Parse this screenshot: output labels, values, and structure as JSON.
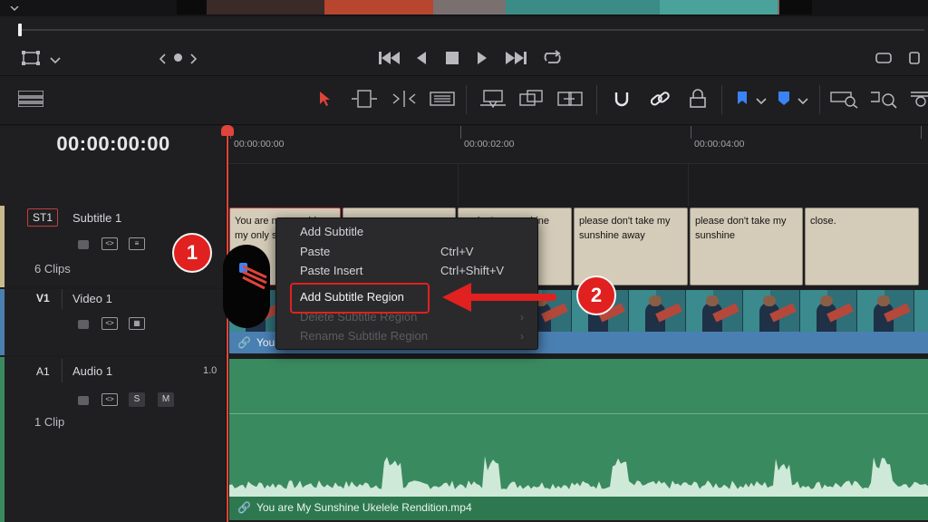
{
  "transport": {
    "viewer_icon": "viewer-mode-icon",
    "dropdown_icon": "chevron-down-icon",
    "nav_icons": [
      "chevron-left-icon",
      "dot-icon",
      "chevron-right-icon"
    ],
    "controls": [
      "skip-to-start-icon",
      "step-back-icon",
      "stop-icon",
      "play-icon",
      "skip-to-end-icon",
      "loop-icon"
    ],
    "right_icons": [
      "fullscreen-icon",
      "more-icon"
    ]
  },
  "timeline": {
    "timecode": "00:00:00:00",
    "ruler_marks": [
      "00:00:00:00",
      "00:00:02:00",
      "00:00:04:00"
    ]
  },
  "tracks": {
    "subtitle": {
      "badge": "ST1",
      "name": "Subtitle 1",
      "info": "6 Clips",
      "clips": [
        "You are my sunshine my only sunshine",
        "",
        "... don't ... sunshine",
        "please don't take my sunshine away",
        "please don't take my sunshine",
        "close."
      ]
    },
    "video": {
      "badge": "V1",
      "name": "Video 1",
      "clip_label": "You"
    },
    "audio": {
      "badge": "A1",
      "name": "Audio 1",
      "level": "1.0",
      "info": "1 Clip",
      "solo_label": "S",
      "mute_label": "M",
      "clip_label": "You are My Sunshine Ukelele Rendition.mp4"
    }
  },
  "context_menu": {
    "items": [
      {
        "label": "Add Subtitle",
        "shortcut": "",
        "enabled": true
      },
      {
        "label": "Paste",
        "shortcut": "Ctrl+V",
        "enabled": true
      },
      {
        "label": "Paste Insert",
        "shortcut": "Ctrl+Shift+V",
        "enabled": true
      },
      {
        "label": "Add Subtitle Region",
        "shortcut": "",
        "enabled": true
      },
      {
        "label": "Delete Subtitle Region",
        "shortcut": "",
        "enabled": false
      },
      {
        "label": "Rename Subtitle Region",
        "shortcut": "",
        "enabled": false
      }
    ]
  },
  "annotations": {
    "step1": "1",
    "step2": "2"
  },
  "colors": {
    "playhead": "#e0443a",
    "annotation_red": "#e0211f",
    "subtitle_clip": "#d4cbb8",
    "video_clip": "#4a7fb2",
    "audio_clip": "#3a8a5f",
    "flag_blue": "#3b82f6"
  }
}
